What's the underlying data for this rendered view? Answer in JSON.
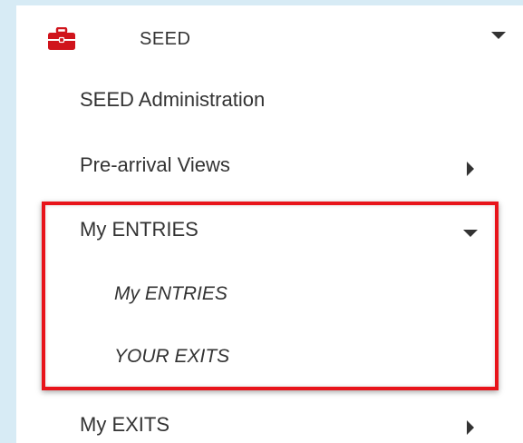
{
  "header": {
    "label": "SEED",
    "icon": "briefcase-icon",
    "icon_color": "#d0141c"
  },
  "menu": {
    "items": [
      {
        "label": "SEED Administration"
      },
      {
        "label": "Pre-arrival Views"
      },
      {
        "label": "My ENTRIES",
        "expanded": true
      },
      {
        "label": "My EXITS"
      }
    ],
    "submenu": [
      {
        "label": "My ENTRIES"
      },
      {
        "label": "YOUR EXITS"
      }
    ]
  },
  "colors": {
    "background": "#d7ebf5",
    "panel": "#ffffff",
    "highlight_border": "#e8141b",
    "text": "#333333"
  }
}
